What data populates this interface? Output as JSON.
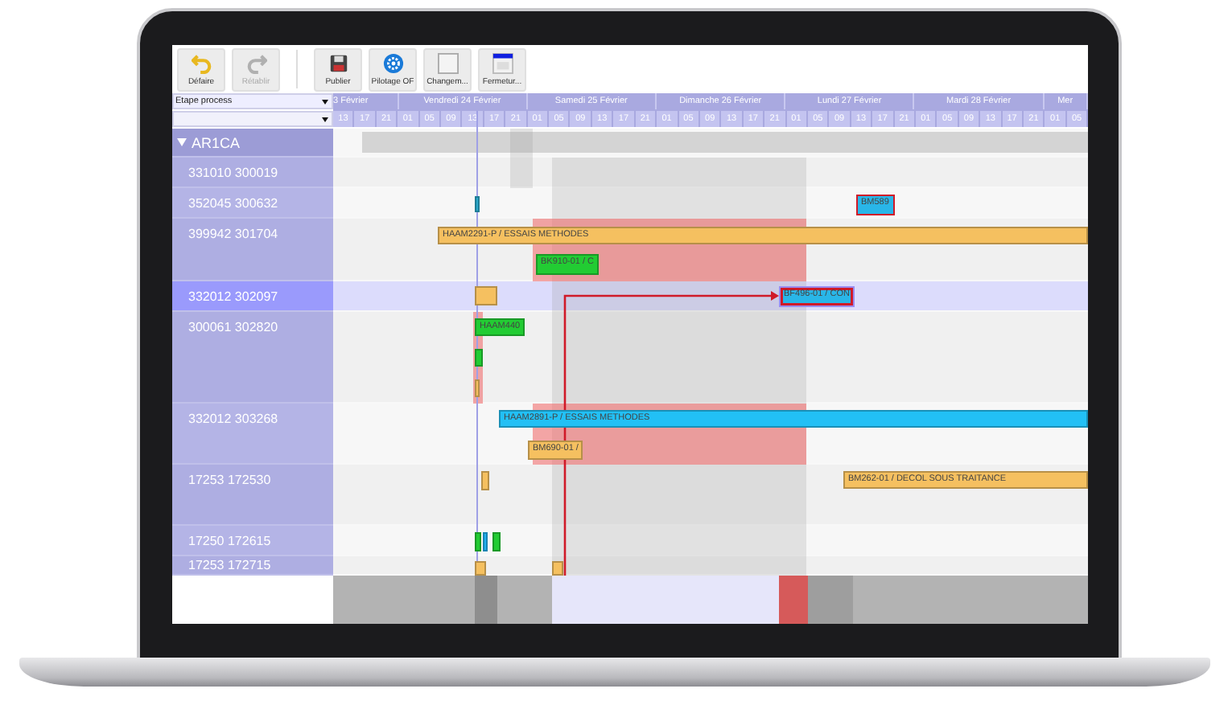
{
  "toolbar": {
    "groups": [
      {
        "buttons": [
          {
            "label": "Défaire",
            "kind": "undo",
            "disabled": false
          },
          {
            "label": "Rétablir",
            "kind": "redo",
            "disabled": true
          }
        ]
      },
      {
        "buttons": [
          {
            "label": "Publier",
            "kind": "save",
            "disabled": false
          },
          {
            "label": "Pilotage OF",
            "kind": "gear",
            "disabled": false
          },
          {
            "label": "Changem...",
            "kind": "blank",
            "disabled": false
          },
          {
            "label": "Fermetur...",
            "kind": "calendar",
            "disabled": false
          }
        ]
      }
    ]
  },
  "filter": {
    "value": "Etape process"
  },
  "timeline": {
    "days": [
      {
        "label": "3 Février",
        "hours": [
          "13",
          "17",
          "21"
        ]
      },
      {
        "label": "Vendredi 24 Février",
        "hours": [
          "01",
          "05",
          "09",
          "13",
          "17",
          "21"
        ]
      },
      {
        "label": "Samedi 25 Février",
        "hours": [
          "01",
          "05",
          "09",
          "13",
          "17",
          "21"
        ]
      },
      {
        "label": "Dimanche 26 Février",
        "hours": [
          "01",
          "05",
          "09",
          "13",
          "17",
          "21"
        ]
      },
      {
        "label": "Lundi 27 Février",
        "hours": [
          "01",
          "05",
          "09",
          "13",
          "17",
          "21"
        ]
      },
      {
        "label": "Mardi 28 Février",
        "hours": [
          "01",
          "05",
          "09",
          "13",
          "17",
          "21"
        ]
      },
      {
        "label": "Mer",
        "hours": [
          "01",
          "05"
        ]
      }
    ]
  },
  "group": {
    "label": "AR1CA",
    "expanded": true
  },
  "rows": [
    {
      "label": "331010 300019",
      "selected": false,
      "bars": []
    },
    {
      "label": "352045 300632",
      "selected": false,
      "bars": [
        {
          "color": "#2aa7c9",
          "flagged": false,
          "selected": false
        },
        {
          "label": "BM589",
          "color": "#29b6e8",
          "flagged": true,
          "selected": false
        }
      ]
    },
    {
      "label": "399942 301704",
      "selected": false,
      "bars": [
        {
          "label": "HAAM2291-P / ESSAIS METHODES",
          "color": "#f5c060",
          "flagged": false,
          "selected": false
        },
        {
          "label": "BK910-01 / C",
          "color": "#22cc33",
          "flagged": false,
          "selected": false
        }
      ]
    },
    {
      "label": "332012 302097",
      "selected": true,
      "bars": [
        {
          "color": "#f5c060",
          "flagged": false,
          "selected": false
        },
        {
          "label": "BF496-01 / CON",
          "color": "#29b6e8",
          "flagged": true,
          "selected": true
        }
      ]
    },
    {
      "label": "300061 302820",
      "selected": false,
      "bars": [
        {
          "label": "HAAM440",
          "color": "#22cc33",
          "flagged": false,
          "selected": false
        },
        {
          "color": "#22cc33",
          "flagged": false,
          "selected": false
        },
        {
          "color": "#f5c060",
          "flagged": false,
          "selected": false
        }
      ]
    },
    {
      "label": "332012 303268",
      "selected": false,
      "bars": [
        {
          "label": "HAAM2891-P / ESSAIS METHODES",
          "color": "#22c0f5",
          "flagged": false,
          "selected": false
        },
        {
          "label": "BM690-01 /",
          "color": "#f5c060",
          "flagged": false,
          "selected": false
        }
      ]
    },
    {
      "label": "17253 172530",
      "selected": false,
      "bars": [
        {
          "color": "#f5c060",
          "flagged": false,
          "selected": false
        },
        {
          "label": "BM262-01 / DECOL SOUS TRAITANCE",
          "color": "#f5c060",
          "flagged": false,
          "selected": false
        }
      ]
    },
    {
      "label": "17250 172615",
      "selected": false,
      "bars": [
        {
          "color": "#22cc33",
          "flagged": false,
          "selected": false
        },
        {
          "color": "#22b0f0",
          "flagged": false,
          "selected": false
        },
        {
          "color": "#22cc33",
          "flagged": false,
          "selected": false
        }
      ]
    },
    {
      "label": "17253 172715",
      "selected": false,
      "bars": [
        {
          "color": "#f5c060",
          "flagged": false,
          "selected": false
        },
        {
          "color": "#f5c060",
          "flagged": false,
          "selected": false
        }
      ]
    }
  ]
}
